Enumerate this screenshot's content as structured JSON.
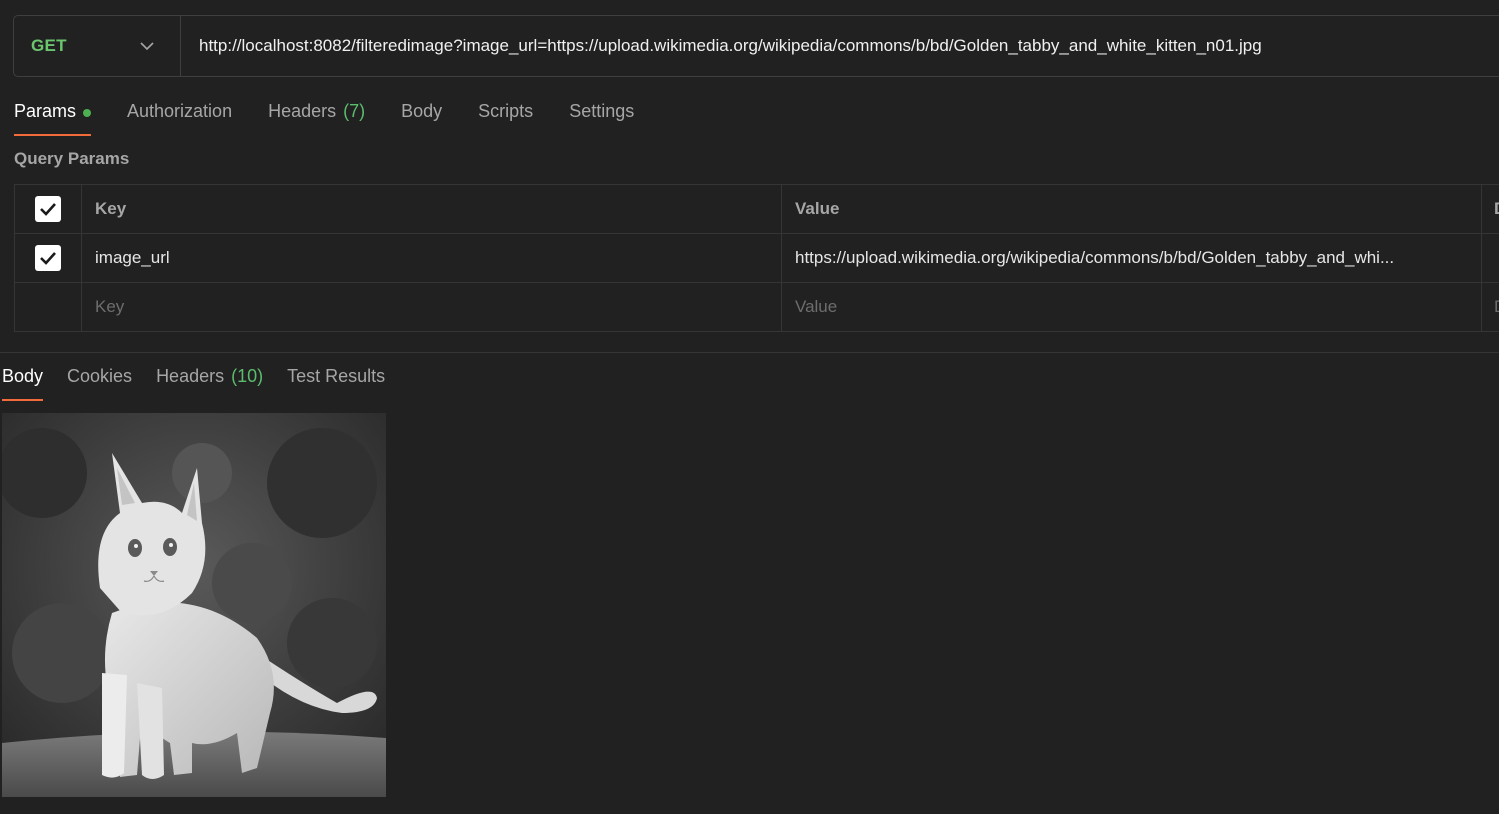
{
  "request": {
    "method": "GET",
    "url": "http://localhost:8082/filteredimage?image_url=https://upload.wikimedia.org/wikipedia/commons/b/bd/Golden_tabby_and_white_kitten_n01.jpg"
  },
  "request_tabs": {
    "params": "Params",
    "authorization": "Authorization",
    "headers": "Headers",
    "headers_count": "(7)",
    "body": "Body",
    "scripts": "Scripts",
    "settings": "Settings"
  },
  "query_params": {
    "title": "Query Params",
    "header_key": "Key",
    "header_value": "Value",
    "header_desc": "D",
    "rows": [
      {
        "key": "image_url",
        "value": "https://upload.wikimedia.org/wikipedia/commons/b/bd/Golden_tabby_and_whi..."
      }
    ],
    "placeholder_key": "Key",
    "placeholder_value": "Value",
    "placeholder_desc": "D"
  },
  "response_tabs": {
    "body": "Body",
    "cookies": "Cookies",
    "headers": "Headers",
    "headers_count": "(10)",
    "test_results": "Test Results"
  },
  "colors": {
    "accent": "#f26b3a",
    "method": "#6bc56f",
    "count": "#5cbc6d",
    "background": "#212121"
  }
}
